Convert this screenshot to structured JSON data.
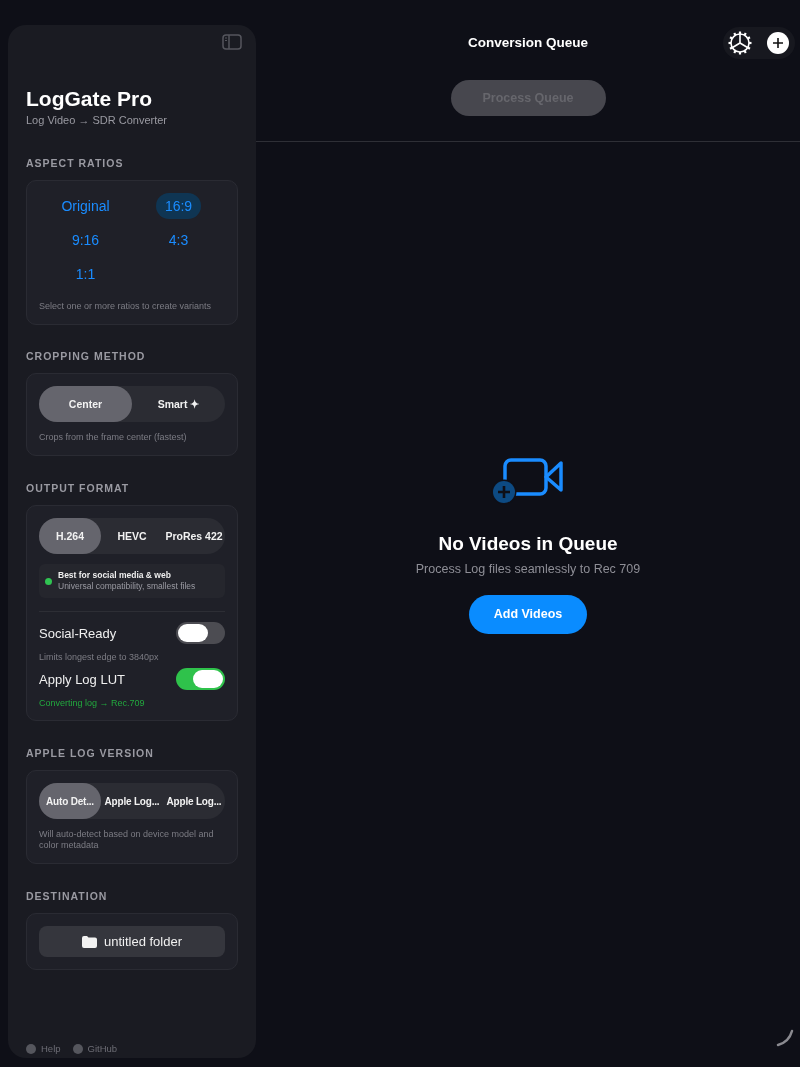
{
  "sidebar": {
    "title": "LogGate Pro",
    "subtitle": "Log Video → SDR Converter",
    "aspect_ratios": {
      "heading": "ASPECT RATIOS",
      "options": [
        {
          "label": "Original",
          "selected": false
        },
        {
          "label": "16:9",
          "selected": true
        },
        {
          "label": "9:16",
          "selected": false
        },
        {
          "label": "4:3",
          "selected": false
        },
        {
          "label": "1:1",
          "selected": false
        }
      ],
      "hint": "Select one or more ratios to create variants"
    },
    "cropping_method": {
      "heading": "CROPPING METHOD",
      "options": [
        {
          "label": "Center",
          "selected": true
        },
        {
          "label": "Smart ✦",
          "selected": false
        }
      ],
      "hint": "Crops from the frame center (fastest)"
    },
    "output_format": {
      "heading": "OUTPUT FORMAT",
      "options": [
        {
          "label": "H.264",
          "selected": true
        },
        {
          "label": "HEVC",
          "selected": false
        },
        {
          "label": "ProRes 422",
          "selected": false
        }
      ],
      "info": {
        "title": "Best for social media & web",
        "detail": "Universal compatibility, smallest files"
      },
      "toggles": [
        {
          "label": "Social-Ready",
          "on": false,
          "note": "Limits longest edge to 3840px"
        },
        {
          "label": "Apply Log LUT",
          "on": true,
          "note": "Converting log → Rec.709"
        }
      ]
    },
    "apple_log_version": {
      "heading": "APPLE LOG VERSION",
      "options": [
        {
          "label": "Auto Det...",
          "selected": true
        },
        {
          "label": "Apple Log...",
          "selected": false
        },
        {
          "label": "Apple Log...",
          "selected": false
        }
      ],
      "hint": "Will auto-detect based on device model and color metadata"
    },
    "destination": {
      "heading": "DESTINATION",
      "folder": "untitled folder"
    },
    "footer_links": [
      "Help",
      "GitHub"
    ]
  },
  "main": {
    "title": "Conversion Queue",
    "process_button": {
      "label": "Process Queue",
      "disabled": true
    },
    "empty_state": {
      "title": "No Videos in Queue",
      "message": "Process Log files seamlessly to Rec 709",
      "button": "Add Videos"
    }
  }
}
